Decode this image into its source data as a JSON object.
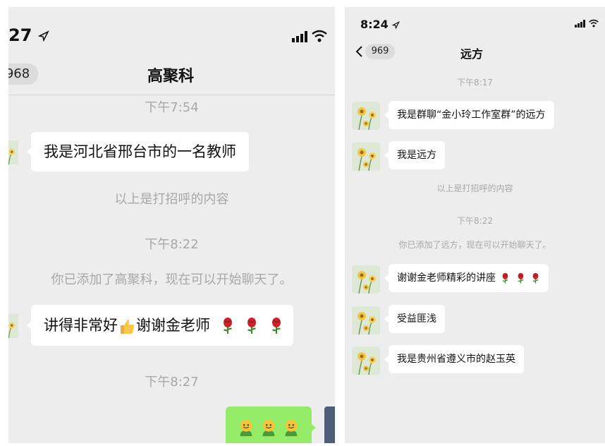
{
  "left": {
    "status_time": "27",
    "back_count": "968",
    "title": "高聚科",
    "time1": "下午7:54",
    "msg1": "我是河北省邢台市的一名教师",
    "sys1": "以上是打招呼的内容",
    "time2": "下午8:22",
    "sys2": "你已添加了高聚科，现在可以开始聊天了。",
    "msg2_text": "讲得非常好",
    "msg2_text2": "谢谢金老师",
    "time3": "下午8:27"
  },
  "right": {
    "status_time": "8:24",
    "back_count": "969",
    "title": "远方",
    "time1": "下午8:17",
    "msg1": "我是群聊“金小玲工作室群”的远方",
    "msg2": "我是远方",
    "sys1": "以上是打招呼的内容",
    "time2": "下午8:22",
    "sys2": "你已添加了远方，现在可以开始聊天了。",
    "msg3": "谢谢金老师精彩的讲座",
    "msg4": "受益匪浅",
    "msg5": "我是贵州省遵义市的赵玉英"
  },
  "colors": {
    "chat_bg": "#ededed",
    "bubble_white": "#ffffff",
    "bubble_green": "#95ec69",
    "system_text": "#a8a8a8"
  },
  "icons": [
    "location-arrow-icon",
    "signal-icon",
    "wifi-icon",
    "back-chevron-icon",
    "rose-icon",
    "thumbs-up-icon",
    "smiley-icon",
    "flower-avatar"
  ]
}
